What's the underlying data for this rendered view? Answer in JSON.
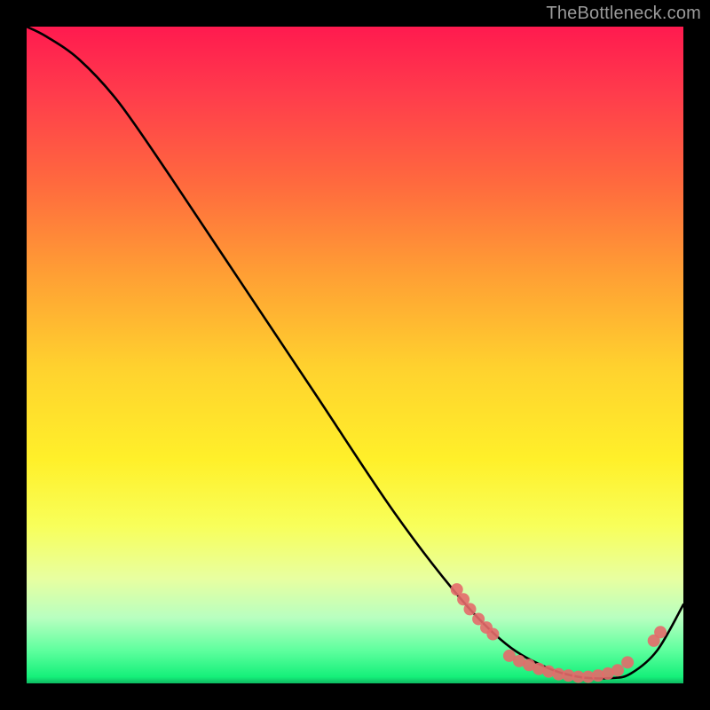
{
  "watermark": "TheBottleneck.com",
  "chart_data": {
    "type": "line",
    "title": "",
    "xlabel": "",
    "ylabel": "",
    "xlim": [
      0,
      1
    ],
    "ylim": [
      0,
      1
    ],
    "series": [
      {
        "name": "curve",
        "x": [
          0.0,
          0.03,
          0.08,
          0.14,
          0.22,
          0.32,
          0.44,
          0.56,
          0.66,
          0.73,
          0.79,
          0.84,
          0.89,
          0.92,
          0.96,
          1.0
        ],
        "y": [
          1.0,
          0.985,
          0.95,
          0.885,
          0.77,
          0.62,
          0.44,
          0.26,
          0.13,
          0.06,
          0.025,
          0.01,
          0.008,
          0.015,
          0.05,
          0.12
        ]
      },
      {
        "name": "markers-left-cluster",
        "type": "scatter",
        "x": [
          0.655,
          0.665,
          0.675,
          0.688,
          0.7,
          0.71
        ],
        "y": [
          0.143,
          0.128,
          0.113,
          0.098,
          0.085,
          0.075
        ]
      },
      {
        "name": "markers-valley",
        "type": "scatter",
        "x": [
          0.735,
          0.75,
          0.765,
          0.78,
          0.795,
          0.81,
          0.825,
          0.84,
          0.855,
          0.87,
          0.885,
          0.9,
          0.915
        ],
        "y": [
          0.042,
          0.034,
          0.028,
          0.022,
          0.018,
          0.014,
          0.012,
          0.01,
          0.01,
          0.012,
          0.015,
          0.02,
          0.032
        ]
      },
      {
        "name": "markers-right",
        "type": "scatter",
        "x": [
          0.955,
          0.965
        ],
        "y": [
          0.065,
          0.078
        ]
      }
    ],
    "colors": {
      "curve": "#000000",
      "markers": "#e46a6a"
    }
  }
}
